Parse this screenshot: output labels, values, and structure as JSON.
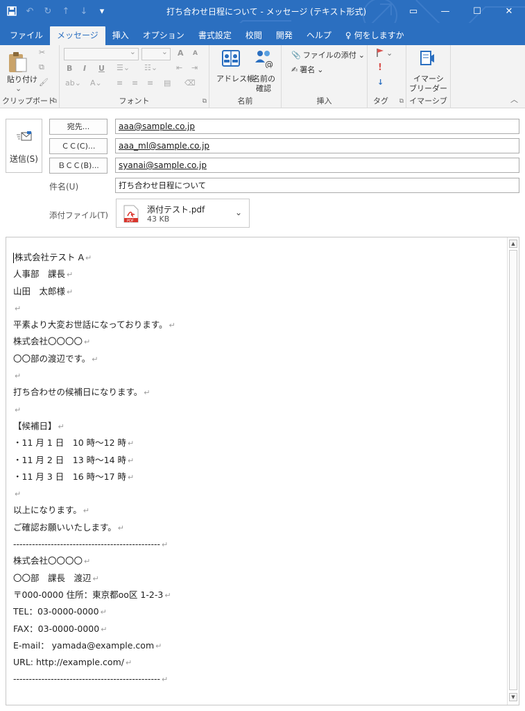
{
  "window": {
    "title": "打ち合わせ日程について - メッセージ (テキスト形式)",
    "controls": [
      "▭",
      "—",
      "☐",
      "✕"
    ]
  },
  "qat": {
    "save": "💾",
    "undo": "↶",
    "redo": "↻",
    "up": "↑",
    "down": "↓",
    "more": "▾"
  },
  "tabs": [
    {
      "label": "ファイル"
    },
    {
      "label": "メッセージ",
      "active": true
    },
    {
      "label": "挿入"
    },
    {
      "label": "オプション"
    },
    {
      "label": "書式設定"
    },
    {
      "label": "校閲"
    },
    {
      "label": "開発"
    },
    {
      "label": "ヘルプ"
    },
    {
      "label": "何をしますか"
    }
  ],
  "ribbon": {
    "clipboard": {
      "label": "クリップボード",
      "paste": "貼り付け"
    },
    "font": {
      "label": "フォント",
      "bold": "B",
      "italic": "I",
      "underline": "U",
      "grow": "A",
      "shrink": "A"
    },
    "names": {
      "label": "名前",
      "addressbook": "アドレス帳",
      "checknames_1": "名前の",
      "checknames_2": "確認"
    },
    "insert": {
      "label": "挿入",
      "attach": "ファイルの添付",
      "signature": "署名"
    },
    "tags": {
      "label": "タグ"
    },
    "immersive": {
      "label": "イマーシブ",
      "reader_1": "イマーシ",
      "reader_2": "ブリーダー"
    }
  },
  "header": {
    "send": "送信(S)",
    "to_button": "宛先...",
    "cc_button": "ＣＣ(C)...",
    "bcc_button": "ＢＣＣ(B)...",
    "to": "aaa@sample.co.jp",
    "cc": "aaa_ml@sample.co.jp",
    "bcc": "syanai@sample.co.jp",
    "subject_label": "件名(U)",
    "subject": "打ち合わせ日程について",
    "attach_label": "添付ファイル(T)",
    "attachment": {
      "name": "添付テスト.pdf",
      "size": "43 KB"
    }
  },
  "body": {
    "lines": [
      "株式会社テスト A",
      "人事部　課長",
      "山田　太郎様",
      "",
      "平素より大変お世話になっております。",
      "株式会社〇〇〇〇",
      "〇〇部の渡辺です。",
      "",
      "打ち合わせの候補日になります。",
      "",
      "【候補日】",
      "・11 月 1 日　10 時～12 時",
      "・11 月 2 日　13 時～14 時",
      "・11 月 3 日　16 時～17 時",
      "",
      "以上になります。",
      "ご確認お願いいたします。",
      "-----------------------------------------------",
      "株式会社〇〇〇〇",
      "〇〇部　課長　渡辺",
      "〒000-0000 住所：東京都oo区 1-2-3",
      "TEL：03-0000-0000",
      "FAX：03-0000-0000",
      "E-mail：  yamada@example.com",
      "URL: http://example.com/",
      "-----------------------------------------------"
    ],
    "return_mark": "↵"
  },
  "colors": {
    "accent": "#2b6fc0",
    "ribbon_bg": "#f3f3f3",
    "flag": "#d9534f"
  }
}
